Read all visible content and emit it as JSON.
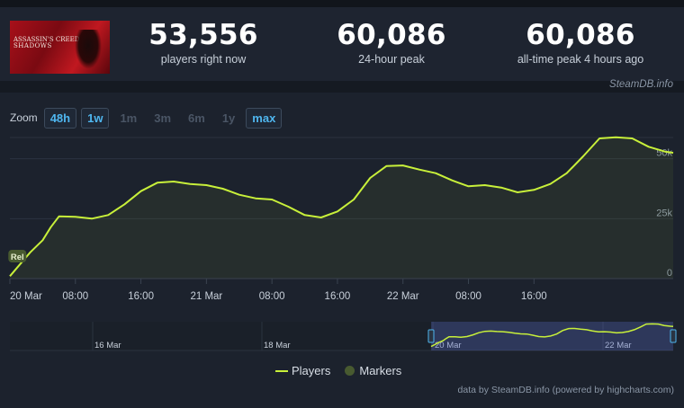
{
  "game": {
    "title_line1": "ASSASSIN'S CREED",
    "title_line2": "SHADOWS"
  },
  "stats": [
    {
      "value": "53,556",
      "label": "players right now"
    },
    {
      "value": "60,086",
      "label": "24-hour peak"
    },
    {
      "value": "60,086",
      "label": "all-time peak 4 hours ago"
    }
  ],
  "watermark": "SteamDB.info",
  "zoom": {
    "label": "Zoom",
    "buttons": [
      "48h",
      "1w",
      "1m",
      "3m",
      "6m",
      "1y",
      "max"
    ],
    "active": [
      "48h",
      "1w",
      "max"
    ]
  },
  "colors": {
    "series": "#c8f03a",
    "marker": "#485a30",
    "active_zoom": "#4fb6ef"
  },
  "chart_data": {
    "type": "line",
    "x_ticks": [
      "20 Mar",
      "08:00",
      "16:00",
      "21 Mar",
      "08:00",
      "16:00",
      "22 Mar",
      "08:00",
      "16:00"
    ],
    "y_ticks": [
      "0",
      "25k",
      "50k"
    ],
    "ylim": [
      0,
      60000
    ],
    "series": [
      {
        "name": "Players",
        "x_hours": [
          0,
          1.5,
          2.5,
          4,
          5,
          6,
          8,
          10,
          12,
          14,
          16,
          18,
          20,
          22,
          24,
          26,
          28,
          30,
          32,
          34,
          36,
          38,
          40,
          42,
          44,
          46,
          48,
          50,
          52,
          54,
          56,
          58,
          60,
          62,
          64,
          66,
          68,
          70,
          72,
          74,
          76,
          78,
          80,
          81
        ],
        "values": [
          1000,
          7000,
          11000,
          16000,
          21500,
          26000,
          25800,
          25000,
          26500,
          31000,
          36500,
          40000,
          40500,
          39500,
          39000,
          37500,
          35000,
          33500,
          33000,
          30000,
          26500,
          25500,
          28000,
          33000,
          42000,
          47000,
          47200,
          45500,
          44000,
          41000,
          38500,
          39000,
          38000,
          36000,
          37000,
          39500,
          44000,
          51000,
          58500,
          59000,
          58500,
          55000,
          53000,
          52500
        ]
      }
    ],
    "markers": [
      {
        "label": "Rel",
        "x_hours": 0.8,
        "value": 9000
      }
    ],
    "navigator": {
      "ticks": [
        "16 Mar",
        "18 Mar",
        "20 Mar",
        "22 Mar"
      ]
    }
  },
  "legend": [
    "Players",
    "Markers"
  ],
  "credits": "data by SteamDB.info (powered by highcharts.com)"
}
